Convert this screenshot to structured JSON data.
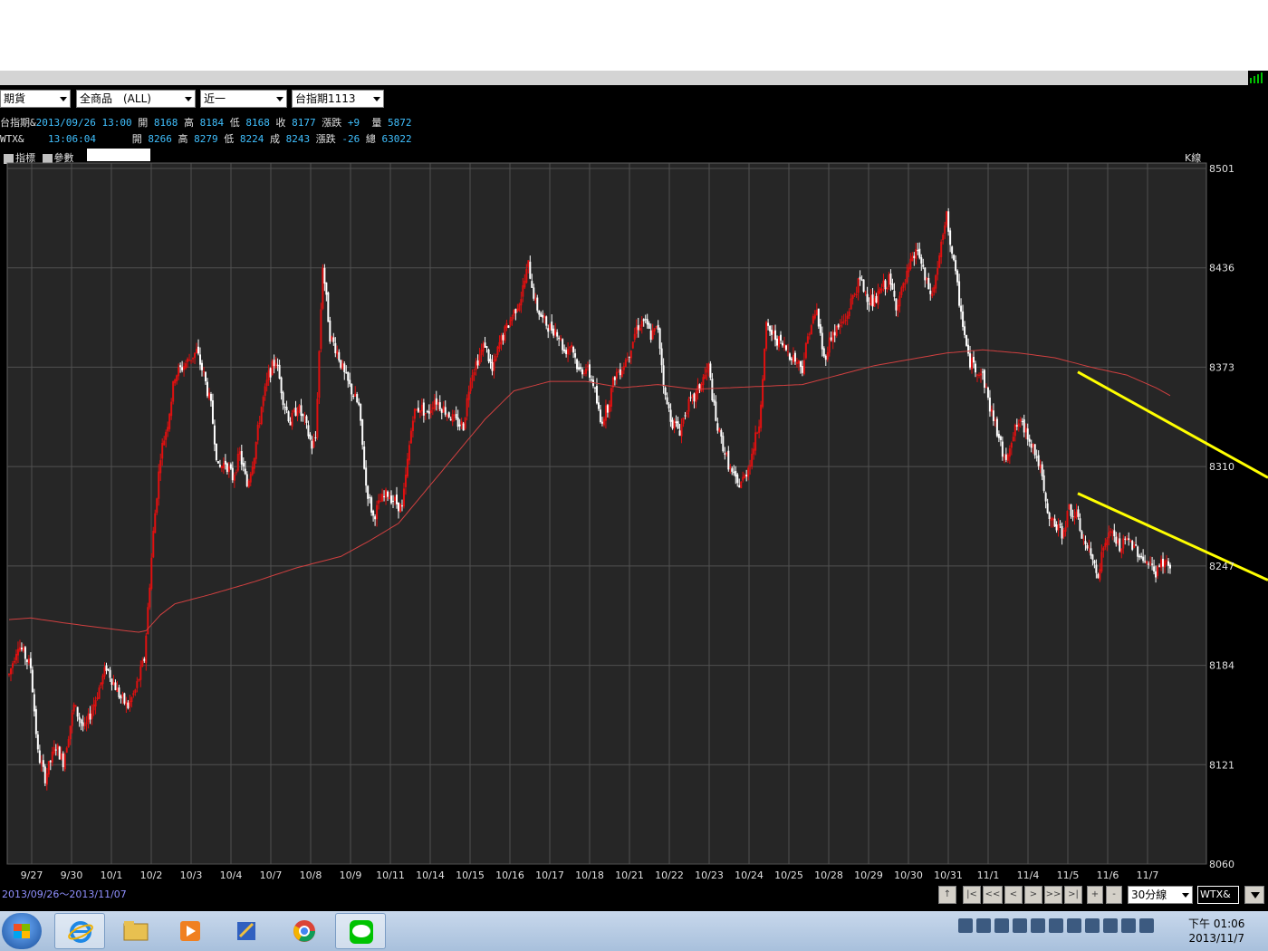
{
  "toolbar": {
    "market": "期貨",
    "products": "全商品　(ALL)",
    "period": "近一",
    "contract": "台指期1113"
  },
  "quote_line1": {
    "name": "台指期&",
    "datetime": "2013/09/26 13:00",
    "open_label": "開",
    "open": "8168",
    "high_label": "高",
    "high": "8184",
    "low_label": "低",
    "low": "8168",
    "close_label": "收",
    "close": "8177",
    "change_label": "漲跌",
    "change": "+9",
    "volume_label": "量",
    "volume": "5872"
  },
  "quote_line2": {
    "name": "WTX&",
    "time": "13:06:04",
    "open_label": "開",
    "open": "8266",
    "high_label": "高",
    "high": "8279",
    "low_label": "低",
    "low": "8224",
    "trade_label": "成",
    "trade": "8243",
    "change_label": "漲跌",
    "change": "-26",
    "total_label": "總",
    "total": "63022"
  },
  "indicator_bar": {
    "indicator": "指標",
    "params": "參數"
  },
  "chart_label": "K線",
  "date_range": "2013/09/26～2013/11/07",
  "nav": {
    "up": "↑",
    "first": "|<",
    "fast_back": "<<",
    "back": "<",
    "forward": ">",
    "fast_forward": ">>",
    "last": ">|",
    "zoom_in": "+",
    "zoom_out": "-"
  },
  "interval": "30分線",
  "symbol": "WTX&",
  "clock": {
    "time": "下午 01:06",
    "date": "2013/11/7"
  },
  "colors": {
    "up": "#e01010",
    "down": "#ffffff",
    "ma": "#d04040",
    "trend": "#ffff00",
    "grid": "#505050"
  },
  "taskbar_icons": [
    "start-orb-icon",
    "internet-explorer-icon",
    "file-explorer-icon",
    "media-player-icon",
    "app-icon",
    "chrome-icon",
    "line-icon"
  ],
  "chart_data": {
    "type": "candlestick",
    "ylim": [
      8060,
      8501
    ],
    "y_ticks": [
      "8501",
      "8436",
      "8373",
      "8310",
      "8247",
      "8184",
      "8121",
      "8060"
    ],
    "x_labels": [
      "9/27",
      "9/30",
      "10/1",
      "10/2",
      "10/3",
      "10/4",
      "10/7",
      "10/8",
      "10/9",
      "10/11",
      "10/14",
      "10/15",
      "10/16",
      "10/17",
      "10/18",
      "10/21",
      "10/22",
      "10/23",
      "10/24",
      "10/25",
      "10/28",
      "10/29",
      "10/30",
      "10/31",
      "11/1",
      "11/4",
      "11/5",
      "11/6",
      "11/7"
    ],
    "price_path": [
      [
        0,
        8180
      ],
      [
        5,
        8200
      ],
      [
        12,
        8185
      ],
      [
        16,
        8130
      ],
      [
        20,
        8115
      ],
      [
        26,
        8135
      ],
      [
        30,
        8125
      ],
      [
        36,
        8160
      ],
      [
        42,
        8145
      ],
      [
        48,
        8165
      ],
      [
        54,
        8185
      ],
      [
        58,
        8175
      ],
      [
        62,
        8165
      ],
      [
        66,
        8160
      ],
      [
        70,
        8170
      ],
      [
        75,
        8190
      ],
      [
        80,
        8270
      ],
      [
        84,
        8320
      ],
      [
        88,
        8340
      ],
      [
        92,
        8370
      ],
      [
        96,
        8375
      ],
      [
        100,
        8380
      ],
      [
        104,
        8385
      ],
      [
        108,
        8370
      ],
      [
        112,
        8350
      ],
      [
        116,
        8310
      ],
      [
        120,
        8315
      ],
      [
        124,
        8305
      ],
      [
        128,
        8320
      ],
      [
        132,
        8300
      ],
      [
        136,
        8320
      ],
      [
        140,
        8350
      ],
      [
        144,
        8370
      ],
      [
        148,
        8380
      ],
      [
        152,
        8355
      ],
      [
        156,
        8340
      ],
      [
        160,
        8350
      ],
      [
        164,
        8340
      ],
      [
        168,
        8325
      ],
      [
        170,
        8330
      ],
      [
        174,
        8440
      ],
      [
        178,
        8395
      ],
      [
        182,
        8385
      ],
      [
        186,
        8370
      ],
      [
        190,
        8360
      ],
      [
        194,
        8350
      ],
      [
        198,
        8300
      ],
      [
        202,
        8280
      ],
      [
        206,
        8290
      ],
      [
        210,
        8295
      ],
      [
        214,
        8290
      ],
      [
        218,
        8285
      ],
      [
        224,
        8345
      ],
      [
        228,
        8350
      ],
      [
        232,
        8345
      ],
      [
        236,
        8355
      ],
      [
        240,
        8350
      ],
      [
        244,
        8345
      ],
      [
        248,
        8340
      ],
      [
        252,
        8338
      ],
      [
        256,
        8370
      ],
      [
        260,
        8380
      ],
      [
        264,
        8390
      ],
      [
        268,
        8372
      ],
      [
        272,
        8390
      ],
      [
        276,
        8400
      ],
      [
        280,
        8410
      ],
      [
        284,
        8420
      ],
      [
        288,
        8440
      ],
      [
        292,
        8415
      ],
      [
        296,
        8405
      ],
      [
        300,
        8400
      ],
      [
        304,
        8398
      ],
      [
        308,
        8385
      ],
      [
        312,
        8390
      ],
      [
        316,
        8372
      ],
      [
        320,
        8375
      ],
      [
        324,
        8365
      ],
      [
        328,
        8340
      ],
      [
        332,
        8350
      ],
      [
        336,
        8370
      ],
      [
        340,
        8375
      ],
      [
        344,
        8385
      ],
      [
        348,
        8400
      ],
      [
        352,
        8405
      ],
      [
        356,
        8395
      ],
      [
        360,
        8400
      ],
      [
        364,
        8355
      ],
      [
        368,
        8340
      ],
      [
        372,
        8335
      ],
      [
        376,
        8350
      ],
      [
        380,
        8355
      ],
      [
        384,
        8365
      ],
      [
        388,
        8375
      ],
      [
        392,
        8340
      ],
      [
        396,
        8325
      ],
      [
        400,
        8310
      ],
      [
        404,
        8300
      ],
      [
        408,
        8305
      ],
      [
        412,
        8320
      ],
      [
        416,
        8340
      ],
      [
        420,
        8400
      ],
      [
        424,
        8395
      ],
      [
        428,
        8390
      ],
      [
        432,
        8385
      ],
      [
        436,
        8380
      ],
      [
        440,
        8375
      ],
      [
        444,
        8400
      ],
      [
        448,
        8410
      ],
      [
        452,
        8380
      ],
      [
        456,
        8395
      ],
      [
        460,
        8400
      ],
      [
        464,
        8405
      ],
      [
        468,
        8420
      ],
      [
        472,
        8430
      ],
      [
        476,
        8420
      ],
      [
        480,
        8415
      ],
      [
        484,
        8425
      ],
      [
        488,
        8430
      ],
      [
        492,
        8415
      ],
      [
        496,
        8425
      ],
      [
        500,
        8440
      ],
      [
        504,
        8450
      ],
      [
        508,
        8430
      ],
      [
        512,
        8420
      ],
      [
        516,
        8445
      ],
      [
        520,
        8470
      ],
      [
        524,
        8440
      ],
      [
        528,
        8410
      ],
      [
        532,
        8380
      ],
      [
        536,
        8375
      ],
      [
        540,
        8370
      ],
      [
        544,
        8350
      ],
      [
        548,
        8335
      ],
      [
        552,
        8315
      ],
      [
        556,
        8330
      ],
      [
        560,
        8340
      ],
      [
        564,
        8335
      ],
      [
        568,
        8325
      ],
      [
        572,
        8310
      ],
      [
        576,
        8280
      ],
      [
        580,
        8275
      ],
      [
        584,
        8270
      ],
      [
        588,
        8285
      ],
      [
        592,
        8280
      ],
      [
        596,
        8265
      ],
      [
        600,
        8255
      ],
      [
        604,
        8245
      ],
      [
        608,
        8265
      ],
      [
        612,
        8270
      ],
      [
        616,
        8260
      ],
      [
        620,
        8265
      ],
      [
        624,
        8262
      ],
      [
        628,
        8255
      ],
      [
        632,
        8250
      ],
      [
        636,
        8245
      ],
      [
        640,
        8252
      ],
      [
        644,
        8248
      ]
    ],
    "ma_path": [
      [
        0,
        8215
      ],
      [
        12,
        8216
      ],
      [
        30,
        8213
      ],
      [
        50,
        8210
      ],
      [
        64,
        8208
      ],
      [
        72,
        8207
      ],
      [
        76,
        8208
      ],
      [
        84,
        8218
      ],
      [
        92,
        8225
      ],
      [
        112,
        8231
      ],
      [
        136,
        8239
      ],
      [
        160,
        8248
      ],
      [
        184,
        8255
      ],
      [
        200,
        8265
      ],
      [
        216,
        8276
      ],
      [
        232,
        8298
      ],
      [
        248,
        8320
      ],
      [
        264,
        8342
      ],
      [
        280,
        8360
      ],
      [
        300,
        8366
      ],
      [
        320,
        8366
      ],
      [
        340,
        8362
      ],
      [
        360,
        8364
      ],
      [
        380,
        8361
      ],
      [
        400,
        8362
      ],
      [
        420,
        8363
      ],
      [
        440,
        8364
      ],
      [
        460,
        8370
      ],
      [
        480,
        8376
      ],
      [
        500,
        8380
      ],
      [
        520,
        8384
      ],
      [
        540,
        8386
      ],
      [
        560,
        8384
      ],
      [
        580,
        8381
      ],
      [
        600,
        8375
      ],
      [
        620,
        8370
      ],
      [
        636,
        8362
      ],
      [
        644,
        8357
      ]
    ],
    "ma_end": 644,
    "bar_count": 645,
    "trend_lines": [
      {
        "from": [
          8360,
          8372
        ],
        "to": [
          1400,
          8305
        ]
      },
      {
        "from": [
          8360,
          8295
        ],
        "to": [
          1400,
          8240
        ]
      }
    ]
  }
}
